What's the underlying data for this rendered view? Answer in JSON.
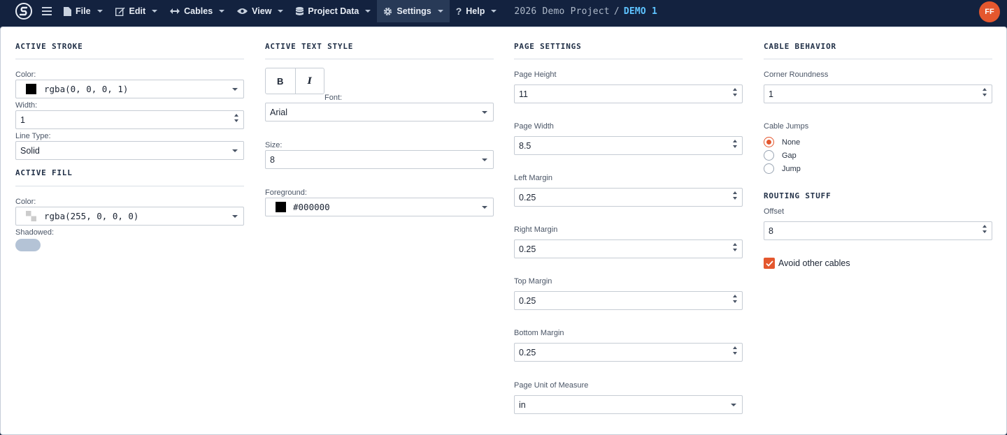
{
  "app": {
    "logo_icon": "app-logo-icon",
    "menu": {
      "file": "File",
      "edit": "Edit",
      "cables": "Cables",
      "view": "View",
      "project_data": "Project Data",
      "settings": "Settings",
      "help": "Help"
    },
    "project": "2026 Demo Project",
    "separator": "/",
    "page_name": "DEMO 1",
    "avatar_initials": "FF",
    "accent_color": "#e4572e"
  },
  "stroke": {
    "title": "ACTIVE STROKE",
    "color_label": "Color:",
    "color_value": "rgba(0, 0, 0, 1)",
    "width_label": "Width:",
    "width_value": "1",
    "linetype_label": "Line Type:",
    "linetype_value": "Solid"
  },
  "fill": {
    "title": "ACTIVE FILL",
    "color_label": "Color:",
    "color_value": "rgba(255, 0, 0, 0)",
    "shadowed_label": "Shadowed:",
    "shadowed_on": false
  },
  "text_style": {
    "title": "ACTIVE TEXT STYLE",
    "bold": "B",
    "italic": "I",
    "font_label": "Font:",
    "font_value": "Arial",
    "size_label": "Size:",
    "size_value": "8",
    "fg_label": "Foreground:",
    "fg_value": "#000000"
  },
  "page": {
    "title": "PAGE SETTINGS",
    "height_label": "Page Height",
    "height_value": "11",
    "width_label": "Page Width",
    "width_value": "8.5",
    "left_label": "Left Margin",
    "left_value": "0.25",
    "right_label": "Right Margin",
    "right_value": "0.25",
    "top_label": "Top Margin",
    "top_value": "0.25",
    "bottom_label": "Bottom Margin",
    "bottom_value": "0.25",
    "unit_label": "Page Unit of Measure",
    "unit_value": "in"
  },
  "cable": {
    "title": "CABLE BEHAVIOR",
    "corner_label": "Corner Roundness",
    "corner_value": "1",
    "jumps_label": "Cable Jumps",
    "jumps": [
      {
        "label": "None",
        "checked": true
      },
      {
        "label": "Gap",
        "checked": false
      },
      {
        "label": "Jump",
        "checked": false
      }
    ],
    "routing_title": "ROUTING STUFF",
    "offset_label": "Offset",
    "offset_value": "8",
    "avoid_label": "Avoid other cables",
    "avoid_checked": true
  }
}
